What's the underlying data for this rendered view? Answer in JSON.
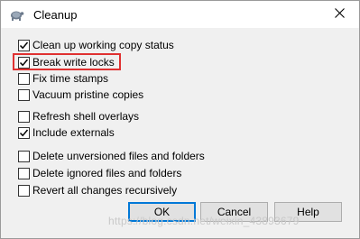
{
  "window": {
    "title": "Cleanup",
    "icon": "tortoise-icon",
    "close_icon": "close-icon"
  },
  "options": [
    {
      "label": "Clean up working copy status",
      "checked": true
    },
    {
      "label": "Break write locks",
      "checked": true,
      "highlighted": true
    },
    {
      "label": "Fix time stamps",
      "checked": false
    },
    {
      "label": "Vacuum pristine copies",
      "checked": false
    },
    {
      "label": "Refresh shell overlays",
      "checked": false
    },
    {
      "label": "Include externals",
      "checked": true
    },
    {
      "label": "Delete unversioned files and folders",
      "checked": false
    },
    {
      "label": "Delete ignored files and folders",
      "checked": false
    },
    {
      "label": "Revert all changes recursively",
      "checked": false
    }
  ],
  "buttons": {
    "ok": "OK",
    "cancel": "Cancel",
    "help": "Help"
  },
  "watermark": "https://blog.csdn.net/weixin_43893679",
  "colors": {
    "highlight": "#e03131",
    "default_button_border": "#0078d7"
  }
}
